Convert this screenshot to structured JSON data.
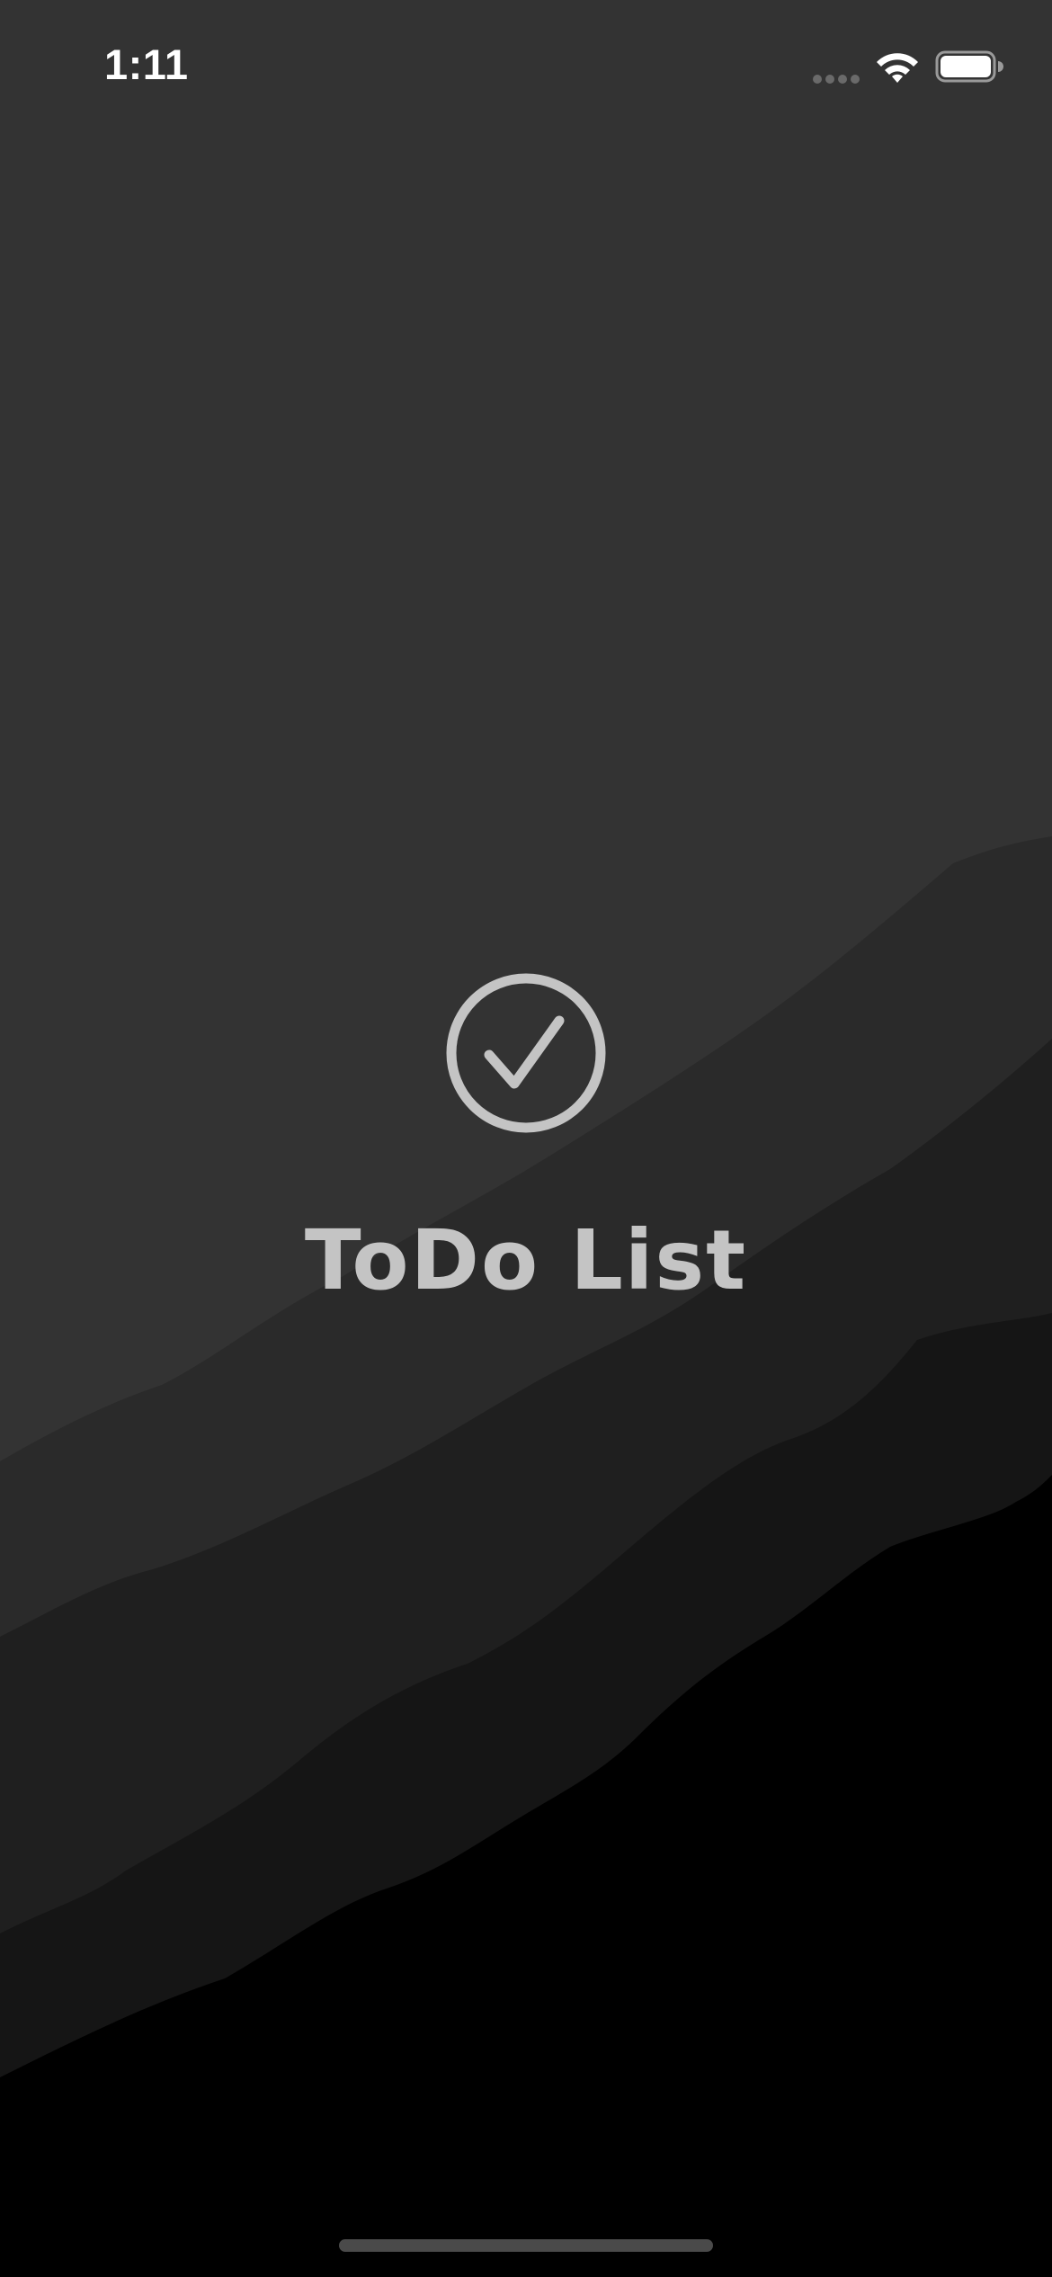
{
  "status_bar": {
    "time": "1:11",
    "icons": [
      "cellular-signal-icon",
      "wifi-icon",
      "battery-icon"
    ]
  },
  "splash": {
    "logo_icon": "checkmark-circle-icon",
    "title": "ToDo List"
  },
  "colors": {
    "sky": "#333333",
    "ridge_1": "#2a2a2a",
    "ridge_2": "#1f1f1f",
    "ridge_3": "#151515",
    "ridge_4": "#000000",
    "logo": "#c4c4c4",
    "title": "#c4c4c4",
    "status_text": "#ffffff"
  }
}
